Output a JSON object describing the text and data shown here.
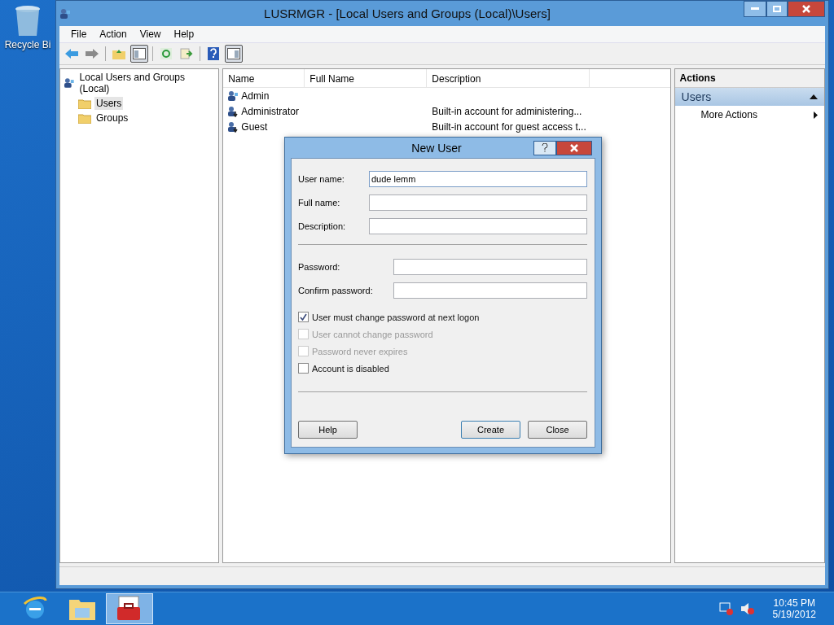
{
  "desktop_icons": [
    {
      "label": "Recycle Bi"
    }
  ],
  "window": {
    "title": "LUSRMGR - [Local Users and Groups (Local)\\Users]"
  },
  "menu": [
    "File",
    "Action",
    "View",
    "Help"
  ],
  "toolbar": [
    {
      "kind": "back",
      "pressed": false
    },
    {
      "kind": "forward",
      "pressed": false
    },
    {
      "kind": "sep"
    },
    {
      "kind": "up",
      "pressed": false
    },
    {
      "kind": "tree",
      "pressed": true
    },
    {
      "kind": "sep"
    },
    {
      "kind": "refresh",
      "pressed": false
    },
    {
      "kind": "export",
      "pressed": false
    },
    {
      "kind": "sep"
    },
    {
      "kind": "help",
      "pressed": false
    },
    {
      "kind": "pane",
      "pressed": true
    }
  ],
  "tree": {
    "label": "Local Users and Groups (Local)",
    "children": [
      {
        "label": "Users",
        "selected": true
      },
      {
        "label": "Groups",
        "selected": false
      }
    ]
  },
  "table": {
    "columns": [
      "Name",
      "Full Name",
      "Description"
    ],
    "rows": [
      {
        "name": "Admin",
        "disabled": false
      },
      {
        "name": "Administrator",
        "description": "Built-in account for administering...",
        "disabled": true
      },
      {
        "name": "Guest",
        "description": "Built-in account for guest access t...",
        "disabled": true
      }
    ]
  },
  "actions": {
    "title": "Actions",
    "section": "Users",
    "expanded": true,
    "items": [
      {
        "label": "More Actions"
      }
    ]
  },
  "dialog": {
    "title": "New User",
    "fields": [
      {
        "label": "User name:",
        "value": "dude lemm",
        "focused": true
      },
      {
        "label": "Full name:",
        "focused": false
      },
      {
        "label": "Description:",
        "focused": false
      }
    ],
    "password_fields": [
      {
        "label": "Password:"
      },
      {
        "label": "Confirm password:"
      }
    ],
    "checkboxes": [
      {
        "label": "User must change password at next logon",
        "checked": true,
        "disabled": false
      },
      {
        "label": "User cannot change password",
        "checked": false,
        "disabled": true
      },
      {
        "label": "Password never expires",
        "checked": false,
        "disabled": true
      },
      {
        "label": "Account is disabled",
        "checked": false,
        "disabled": false
      }
    ],
    "buttons": [
      {
        "label": "Help",
        "default": false
      },
      {
        "label": "Create",
        "default": true
      },
      {
        "label": "Close",
        "default": false
      }
    ]
  },
  "taskbar": {
    "apps": [
      {
        "kind": "browser",
        "selected": false
      },
      {
        "kind": "folder",
        "selected": false
      },
      {
        "kind": "toolbox",
        "selected": true
      }
    ],
    "time": "10:45 PM",
    "date": "5/19/2012"
  }
}
